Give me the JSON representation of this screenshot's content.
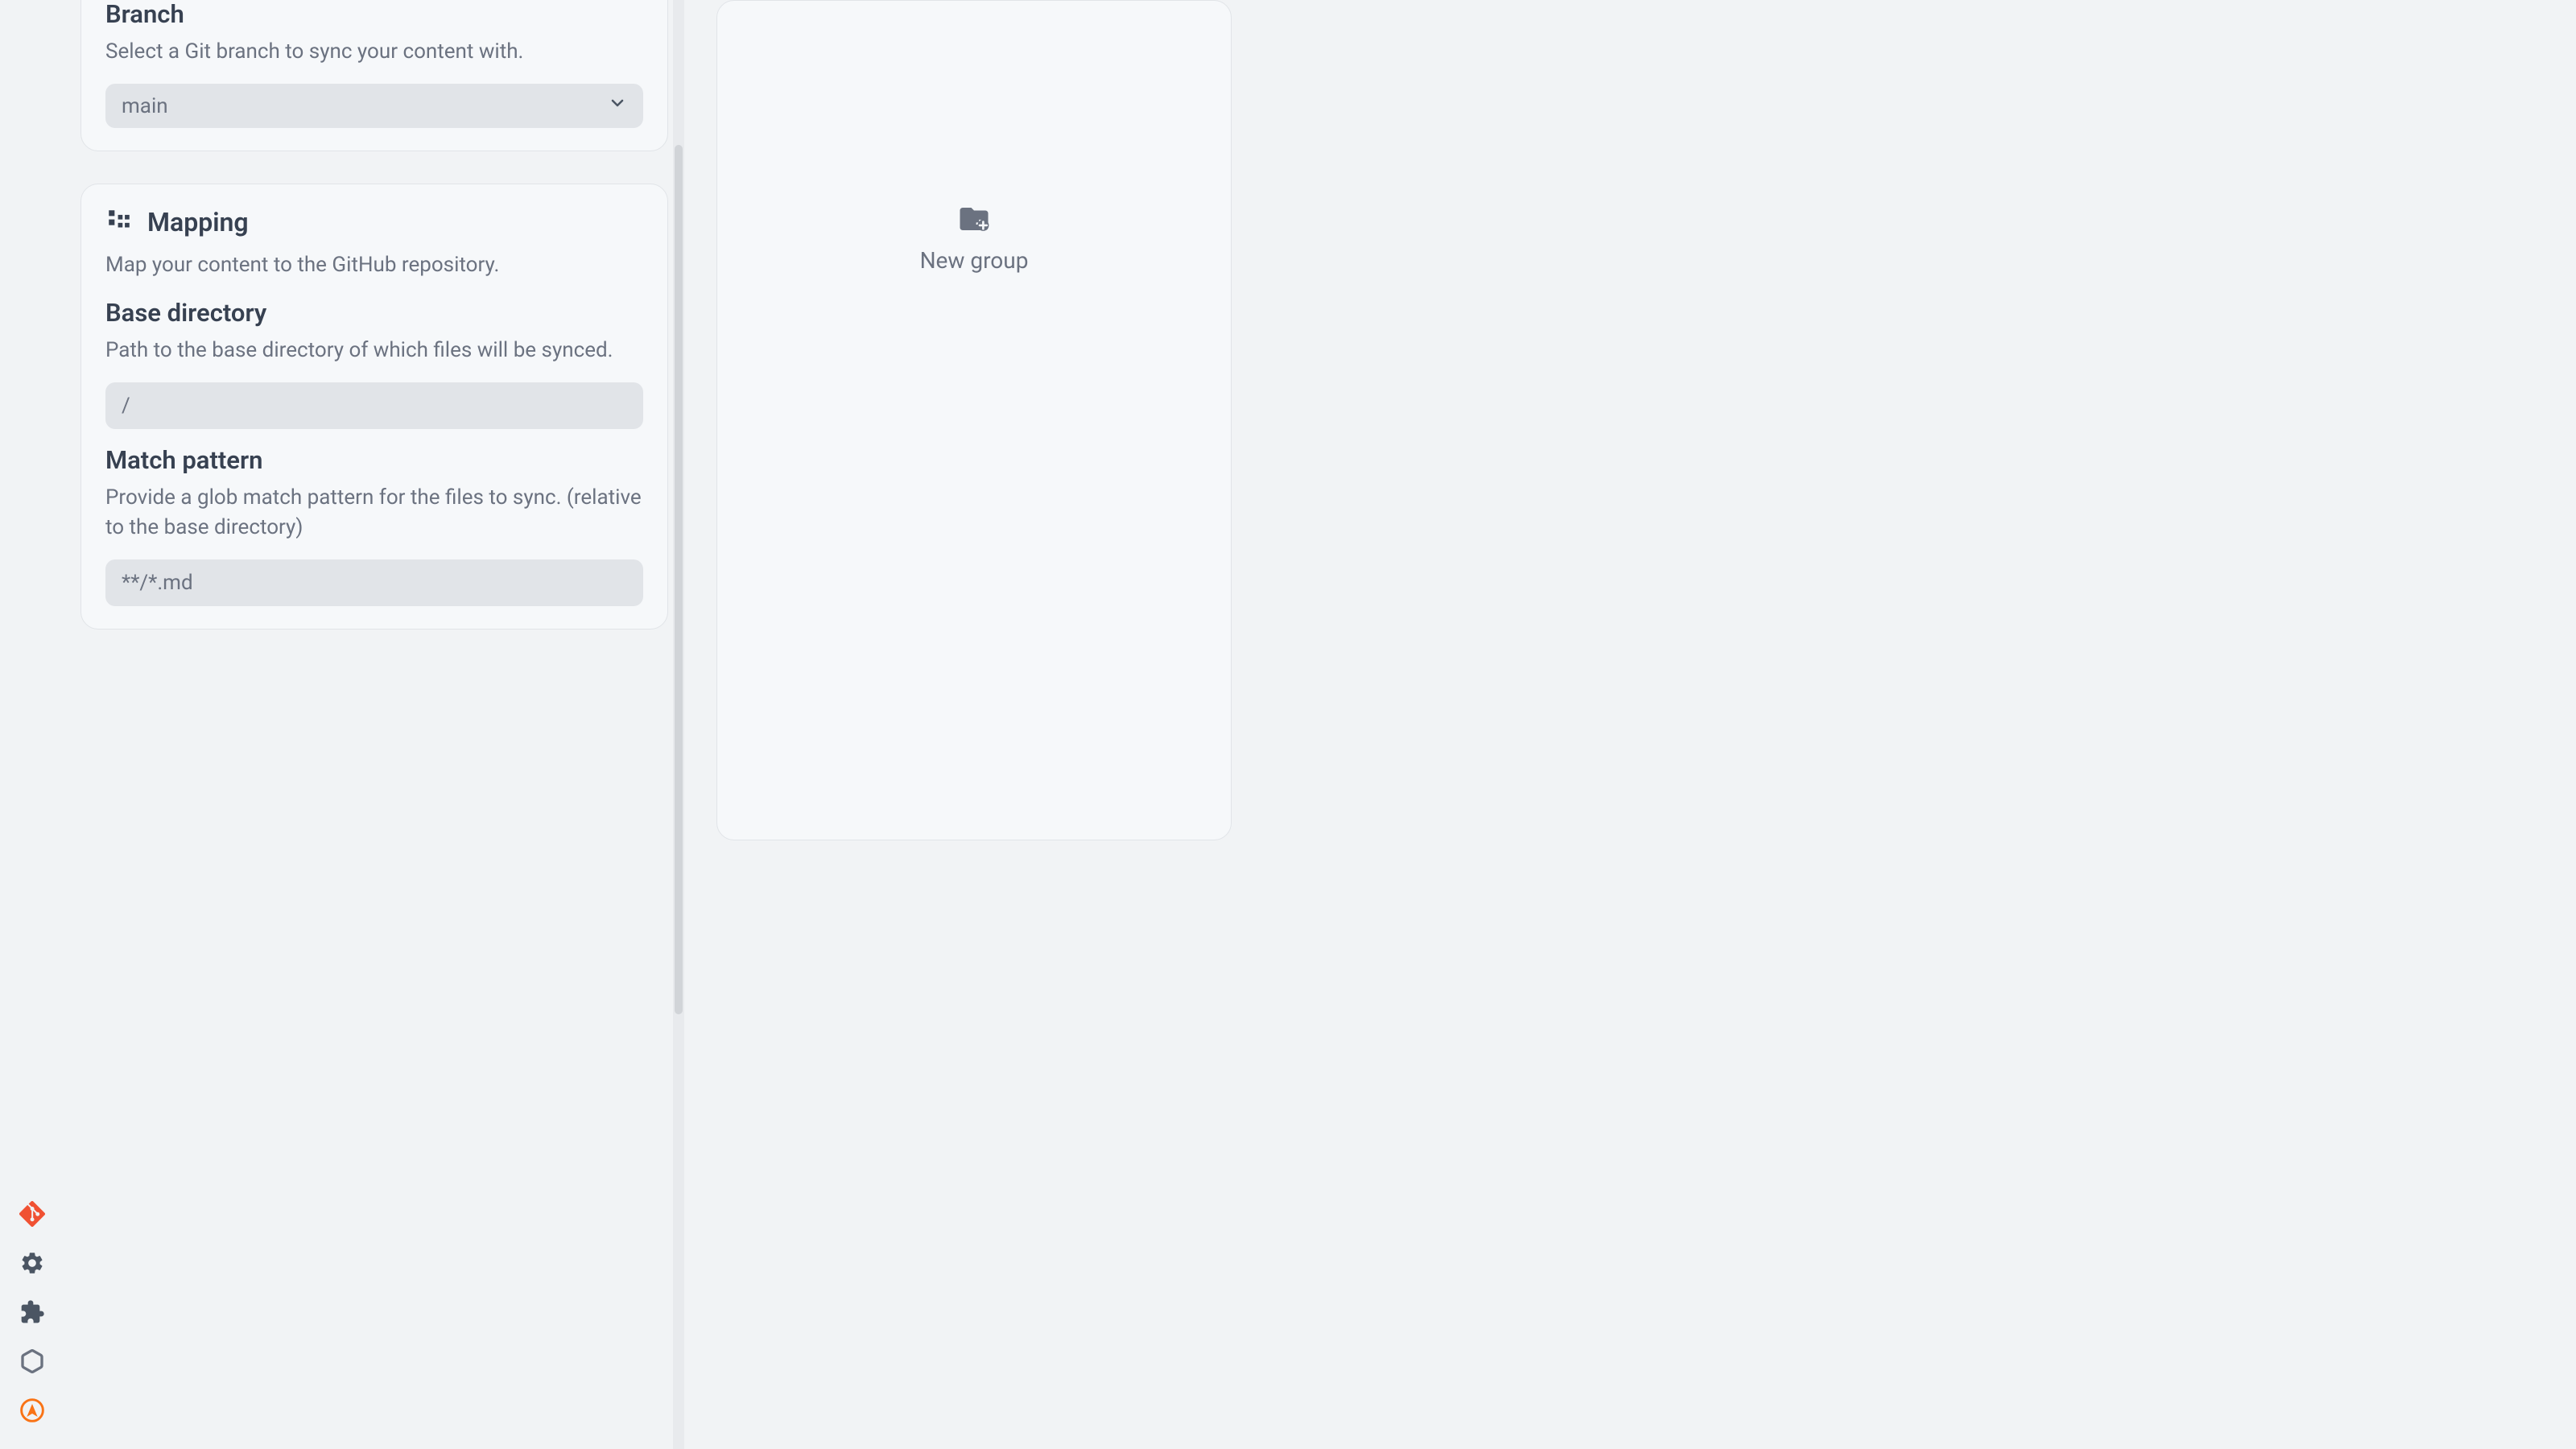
{
  "branch": {
    "heading": "Branch",
    "description": "Select a Git branch to sync your content with.",
    "selected": "main"
  },
  "mapping": {
    "title": "Mapping",
    "description": "Map your content to the GitHub repository.",
    "base_directory": {
      "heading": "Base directory",
      "description": "Path to the base directory of which files will be synced.",
      "value": "/"
    },
    "match_pattern": {
      "heading": "Match pattern",
      "description": "Provide a glob match pattern for the files to sync. (relative to the base directory)",
      "value": "**/*.md"
    }
  },
  "right_panel": {
    "new_group_label": "New group"
  }
}
